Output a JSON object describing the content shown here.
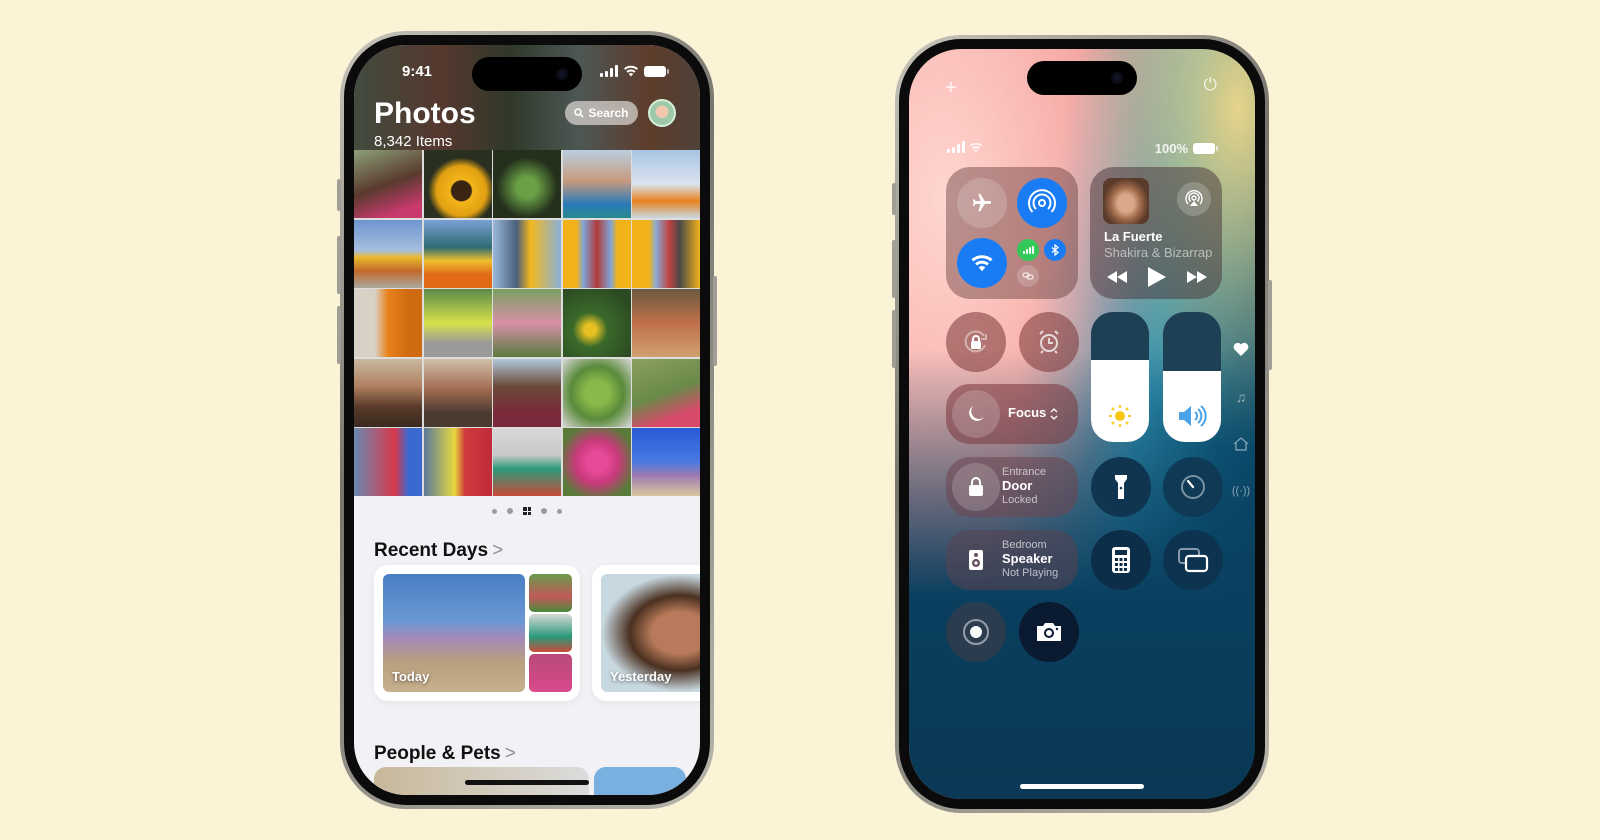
{
  "photos_phone": {
    "status_bar": {
      "time": "9:41",
      "signal_icon": "cellular-bars-icon",
      "wifi_icon": "wifi-icon",
      "battery_icon": "battery-full-icon"
    },
    "header": {
      "title": "Photos",
      "item_count": "8,342 Items",
      "search_label": "Search",
      "search_icon": "magnifier-icon",
      "avatar": "memoji-avatar"
    },
    "photo_grid": {
      "rows": 5,
      "columns": 5,
      "tiles": [
        "woman-in-pink",
        "sunflower",
        "green-plant",
        "smiling-girl-blue-jacket",
        "woman-orange-sari-sky",
        "woman-marigold-garland-beach",
        "woman-orange-skirt",
        "man-marigold-garland",
        "people-marigold-arch",
        "people-marigold-arch-2",
        "orange-sari-sand",
        "child-on-tree",
        "kids-playing",
        "yellow-flowers-field",
        "crowd-with-flowers",
        "group-at-sunset",
        "group-at-sunset-2",
        "smiling-girl",
        "green-vegetables",
        "kids-on-grass",
        "boy-and-woman-with-bags",
        "boy-and-girl-stacking",
        "girl-in-green-dress",
        "pink-bougainvillea",
        "friends-sitting-on-wall"
      ]
    },
    "page_dots": {
      "count": 5,
      "active_index": 2
    },
    "recent_days": {
      "title": "Recent Days",
      "chevron": "chevron-right-icon",
      "cards": [
        {
          "label": "Today"
        },
        {
          "label": "Yesterday"
        }
      ]
    },
    "people_pets": {
      "title": "People & Pets",
      "chevron": "chevron-right-icon"
    }
  },
  "control_center_phone": {
    "top": {
      "add_icon": "+",
      "power_icon": "⏻"
    },
    "status_bar": {
      "battery_percent": "100%"
    },
    "connectivity": {
      "airplane_mode": {
        "icon": "airplane-icon",
        "on": false
      },
      "airdrop": {
        "icon": "airdrop-icon",
        "on": true
      },
      "wifi": {
        "icon": "wifi-icon",
        "on": true
      },
      "cellular": {
        "icon": "cellular-icon",
        "on": true
      },
      "bluetooth": {
        "icon": "bluetooth-icon",
        "on": true
      },
      "personal_hotspot": {
        "icon": "link-icon",
        "on": false
      }
    },
    "now_playing": {
      "title": "La Fuerte",
      "artist": "Shakira & Bizarrap",
      "artist_visible": "Shakira & Bizarra",
      "airplay_icon": "airplay-audio-icon"
    },
    "toggles": {
      "orientation_lock": "rotation-lock-icon",
      "alarm": "alarm-clock-icon",
      "focus_label": "Focus",
      "focus_icon": "moon-icon"
    },
    "brightness": {
      "level": 0.63,
      "icon": "sun-icon"
    },
    "volume": {
      "level": 0.55,
      "icon": "speaker-wave-icon"
    },
    "home_tiles": [
      {
        "subtitle": "Entrance",
        "title": "Door",
        "status": "Locked",
        "icon": "lock-icon"
      },
      {
        "subtitle": "Bedroom",
        "title": "Speaker",
        "status": "Not Playing",
        "icon": "speaker-icon"
      }
    ],
    "utility_buttons": [
      "flashlight-icon",
      "timer-icon",
      "calculator-icon",
      "screen-mirroring-icon",
      "screen-record-icon",
      "camera-icon"
    ],
    "page_indicators": [
      "heart-icon",
      "music-note-icon",
      "home-icon",
      "wireless-icon"
    ]
  },
  "colors": {
    "background": "#fbf3d5",
    "ios_blue": "#1a7cf5",
    "cellular_green": "#34c759"
  }
}
